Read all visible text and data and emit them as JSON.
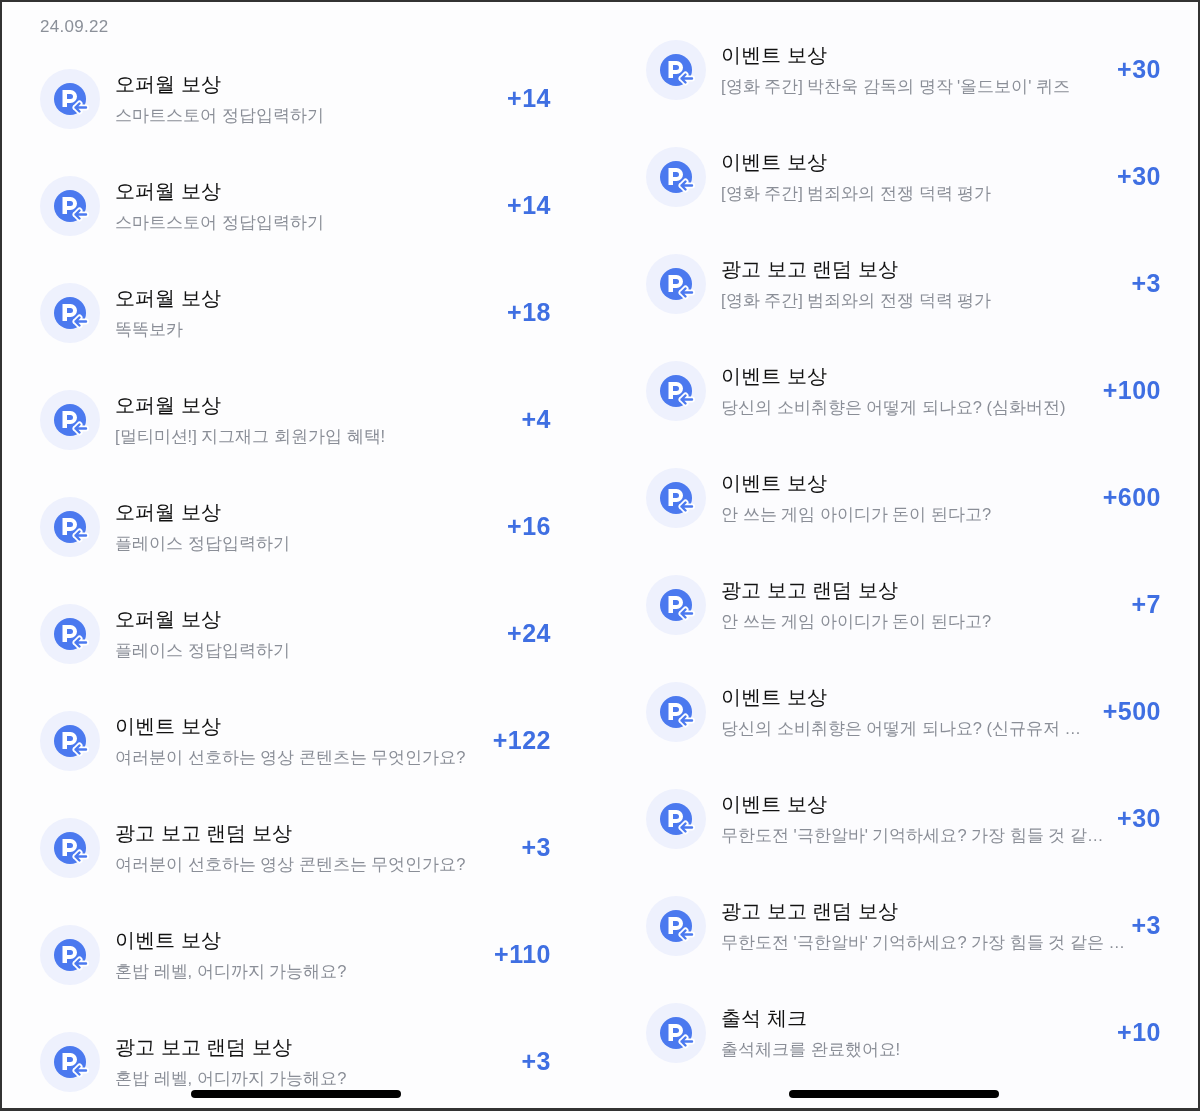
{
  "panels": [
    {
      "date": "24.09.22",
      "items": [
        {
          "title": "오퍼월 보상",
          "subtitle": "스마트스토어 정답입력하기",
          "amount": "+14"
        },
        {
          "title": "오퍼월 보상",
          "subtitle": "스마트스토어 정답입력하기",
          "amount": "+14"
        },
        {
          "title": "오퍼월 보상",
          "subtitle": "똑똑보카",
          "amount": "+18"
        },
        {
          "title": "오퍼월 보상",
          "subtitle": "[멀티미션!] 지그재그 회원가입 혜택!",
          "amount": "+4"
        },
        {
          "title": "오퍼월 보상",
          "subtitle": "플레이스 정답입력하기",
          "amount": "+16"
        },
        {
          "title": "오퍼월 보상",
          "subtitle": "플레이스 정답입력하기",
          "amount": "+24"
        },
        {
          "title": "이벤트 보상",
          "subtitle": "여러분이 선호하는 영상 콘텐츠는 무엇인가요?",
          "amount": "+122"
        },
        {
          "title": "광고 보고 랜덤 보상",
          "subtitle": "여러분이 선호하는 영상 콘텐츠는 무엇인가요?",
          "amount": "+3"
        },
        {
          "title": "이벤트 보상",
          "subtitle": "혼밥 레벨, 어디까지 가능해요?",
          "amount": "+110"
        },
        {
          "title": "광고 보고 랜덤 보상",
          "subtitle": "혼밥 레벨, 어디까지 가능해요?",
          "amount": "+3"
        }
      ]
    },
    {
      "items": [
        {
          "title": "이벤트 보상",
          "subtitle": "[영화 주간] 박찬욱 감독의 명작 '올드보이' 퀴즈",
          "amount": "+30"
        },
        {
          "title": "이벤트 보상",
          "subtitle": "[영화 주간] 범죄와의 전쟁 덕력 평가",
          "amount": "+30"
        },
        {
          "title": "광고 보고 랜덤 보상",
          "subtitle": "[영화 주간] 범죄와의 전쟁 덕력 평가",
          "amount": "+3"
        },
        {
          "title": "이벤트 보상",
          "subtitle": "당신의 소비취향은 어떻게 되나요? (심화버전)",
          "amount": "+100"
        },
        {
          "title": "이벤트 보상",
          "subtitle": "안 쓰는 게임 아이디가 돈이 된다고?",
          "amount": "+600"
        },
        {
          "title": "광고 보고 랜덤 보상",
          "subtitle": "안 쓰는 게임 아이디가 돈이 된다고?",
          "amount": "+7"
        },
        {
          "title": "이벤트 보상",
          "subtitle": "당신의 소비취향은 어떻게 되나요? (신규유저 …",
          "amount": "+500"
        },
        {
          "title": "이벤트 보상",
          "subtitle": "무한도전 '극한알바' 기억하세요? 가장 힘들 것 같…",
          "amount": "+30"
        },
        {
          "title": "광고 보고 랜덤 보상",
          "subtitle": "무한도전 '극한알바' 기억하세요? 가장 힘들 것 같은 …",
          "amount": "+3"
        },
        {
          "title": "출석 체크",
          "subtitle": "출석체크를 완료했어요!",
          "amount": "+10"
        }
      ]
    }
  ]
}
